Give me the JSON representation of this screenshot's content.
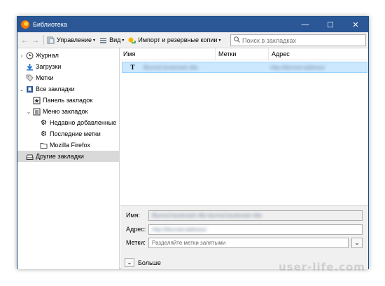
{
  "window": {
    "title": "Библиотека"
  },
  "controls": {
    "minimize": "—",
    "maximize": "☐",
    "close": "✕"
  },
  "toolbar": {
    "back": "←",
    "forward": "→",
    "manage_label": "Управление",
    "view_label": "Вид",
    "import_label": "Импорт и резервные копии",
    "search_placeholder": "Поиск в закладках"
  },
  "sidebar": {
    "items": [
      {
        "label": "Журнал",
        "icon": "clock-icon"
      },
      {
        "label": "Загрузки",
        "icon": "download-icon"
      },
      {
        "label": "Метки",
        "icon": "tag-icon"
      },
      {
        "label": "Все закладки",
        "icon": "bookmarks-icon"
      },
      {
        "label": "Панель закладок",
        "icon": "toolbar-icon"
      },
      {
        "label": "Меню закладок",
        "icon": "menu-icon"
      },
      {
        "label": "Недавно добавленные",
        "icon": "gear-icon"
      },
      {
        "label": "Последние метки",
        "icon": "gear-icon"
      },
      {
        "label": "Mozilla Firefox",
        "icon": "folder-icon"
      },
      {
        "label": "Другие закладки",
        "icon": "drive-icon"
      }
    ]
  },
  "list": {
    "columns": [
      "Имя",
      "Метки",
      "Адрес"
    ],
    "rows": [
      {
        "icon": "T",
        "name": "Blurred bookmark title",
        "tags": "",
        "address": "http://blurred-address/"
      }
    ]
  },
  "details": {
    "name_label": "Имя:",
    "name_value": "Blurred bookmark title blurred bookmark title",
    "address_label": "Адрес:",
    "address_value": "http://blurred-address/",
    "tags_label": "Метки:",
    "tags_placeholder": "Разделяйте метки запятыми",
    "more_label": "Больше"
  },
  "watermark": "user-life.com",
  "colors": {
    "titlebar": "#2b5797",
    "selection": "#cce8ff",
    "selection_border": "#99d1ff"
  }
}
